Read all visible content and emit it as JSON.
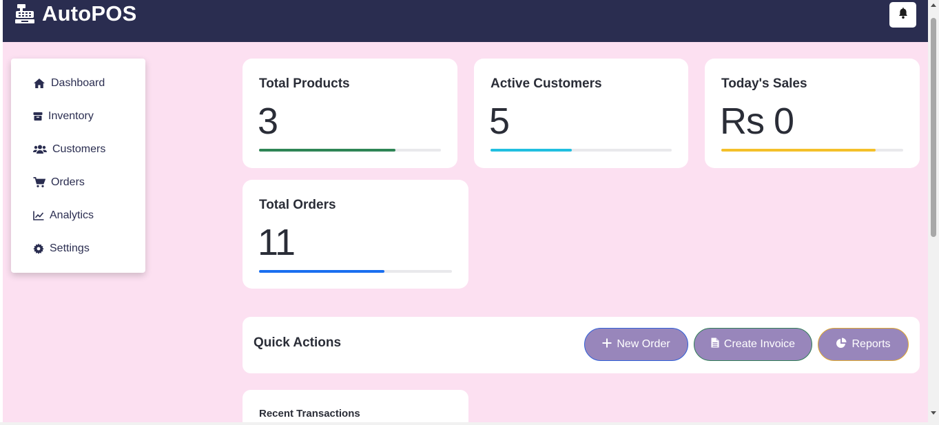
{
  "app": {
    "name": "AutoPOS",
    "brand_icon": "cash-register-icon",
    "header_color": "#2a2d50",
    "page_background": "#fce0f1",
    "notification_icon": "bell-icon"
  },
  "sidebar": {
    "items": [
      {
        "label": "Dashboard",
        "icon": "home-icon"
      },
      {
        "label": "Inventory",
        "icon": "box-icon"
      },
      {
        "label": "Customers",
        "icon": "users-icon"
      },
      {
        "label": "Orders",
        "icon": "cart-icon"
      },
      {
        "label": "Analytics",
        "icon": "line-chart-icon"
      },
      {
        "label": "Settings",
        "icon": "gear-icon"
      }
    ]
  },
  "stats": [
    {
      "title": "Total Products",
      "value": "3",
      "progress": 0.75,
      "color": "#2e8555"
    },
    {
      "title": "Active Customers",
      "value": "5",
      "progress": 0.45,
      "color": "#21bfe0"
    },
    {
      "title": "Today's Sales",
      "value": "Rs 0",
      "progress": 0.85,
      "color": "#f4c02a"
    },
    {
      "title": "Total Orders",
      "value": "11",
      "progress": 0.65,
      "color": "#1a6ff0"
    }
  ],
  "quick_actions": {
    "title": "Quick Actions",
    "buttons": [
      {
        "label": "New Order",
        "icon": "plus-icon",
        "border_color": "#2f5fd8"
      },
      {
        "label": "Create Invoice",
        "icon": "document-icon",
        "border_color": "#2e7d55"
      },
      {
        "label": "Reports",
        "icon": "pie-chart-icon",
        "border_color": "#e0a82e"
      }
    ],
    "button_color": "#9886bb"
  },
  "recent_transactions": {
    "title": "Recent Transactions"
  }
}
